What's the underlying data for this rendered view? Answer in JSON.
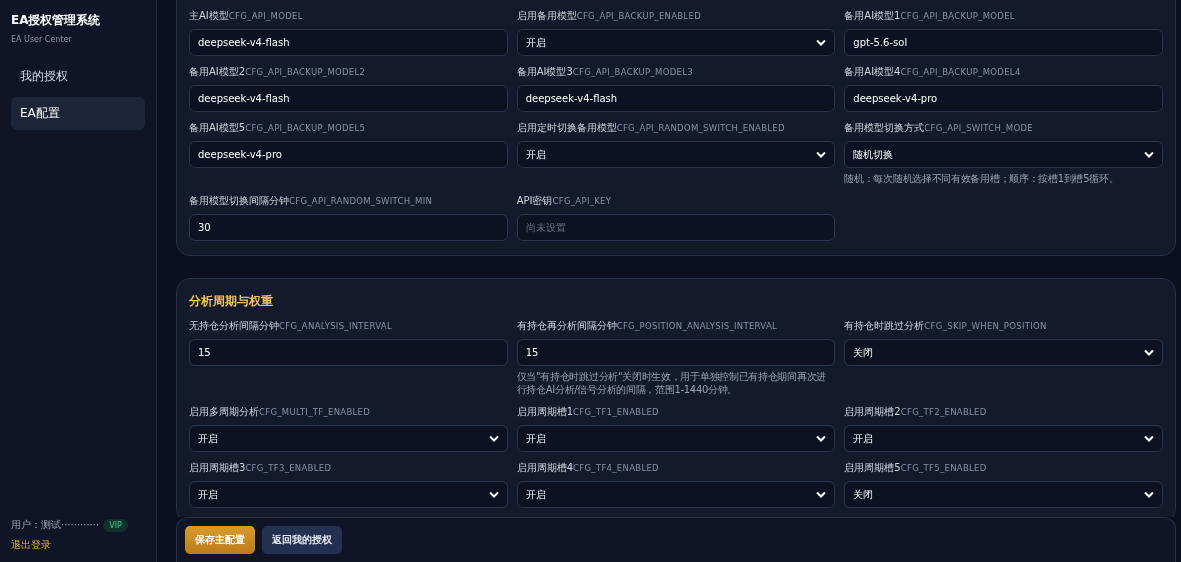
{
  "sidebar": {
    "title": "EA授权管理系统",
    "subtitle": "EA User Center",
    "nav": [
      {
        "label": "我的授权",
        "selected": false
      },
      {
        "label": "EA配置",
        "selected": true
      }
    ],
    "user": {
      "label": "用户：测试············",
      "badge": "VIP",
      "logout": "退出登录"
    }
  },
  "sections": [
    {
      "fields": [
        {
          "kind": "text",
          "label": "主AI模型",
          "key": "CFG_API_MODEL",
          "value": "deepseek-v4-flash"
        },
        {
          "kind": "select",
          "label": "启用备用模型",
          "key": "CFG_API_BACKUP_ENABLED",
          "value": "开启"
        },
        {
          "kind": "text",
          "label": "备用AI模型1",
          "key": "CFG_API_BACKUP_MODEL",
          "value": "gpt-5.6-sol"
        },
        {
          "kind": "text",
          "label": "备用AI模型2",
          "key": "CFG_API_BACKUP_MODEL2",
          "value": "deepseek-v4-flash"
        },
        {
          "kind": "text",
          "label": "备用AI模型3",
          "key": "CFG_API_BACKUP_MODEL3",
          "value": "deepseek-v4-flash"
        },
        {
          "kind": "text",
          "label": "备用AI模型4",
          "key": "CFG_API_BACKUP_MODEL4",
          "value": "deepseek-v4-pro"
        },
        {
          "kind": "text",
          "label": "备用AI模型5",
          "key": "CFG_API_BACKUP_MODEL5",
          "value": "deepseek-v4-pro"
        },
        {
          "kind": "select",
          "label": "启用定时切换备用模型",
          "key": "CFG_API_RANDOM_SWITCH_ENABLED",
          "value": "开启"
        },
        {
          "kind": "select",
          "label": "备用模型切换方式",
          "key": "CFG_API_SWITCH_MODE",
          "value": "随机切换",
          "hint": "随机：每次随机选择不同有效备用槽；顺序：按槽1到槽5循环。"
        },
        {
          "kind": "text",
          "label": "备用模型切换间隔分钟",
          "key": "CFG_API_RANDOM_SWITCH_MIN",
          "value": "30"
        },
        {
          "kind": "password",
          "label": "API密钥",
          "key": "CFG_API_KEY",
          "placeholder": "尚未设置"
        }
      ]
    },
    {
      "title": "分析周期与权重",
      "fields": [
        {
          "kind": "text",
          "label": "无持仓分析间隔分钟",
          "key": "CFG_ANALYSIS_INTERVAL",
          "value": "15"
        },
        {
          "kind": "text",
          "label": "有持仓再分析间隔分钟",
          "key": "CFG_POSITION_ANALYSIS_INTERVAL",
          "value": "15",
          "hint": "仅当\"有持仓时跳过分析\"关闭时生效，用于单独控制已有持仓期间再次进行持仓AI分析/信号分析的间隔，范围1-1440分钟。"
        },
        {
          "kind": "select",
          "label": "有持仓时跳过分析",
          "key": "CFG_SKIP_WHEN_POSITION",
          "value": "关闭"
        },
        {
          "kind": "select",
          "label": "启用多周期分析",
          "key": "CFG_MULTI_TF_ENABLED",
          "value": "开启"
        },
        {
          "kind": "select",
          "label": "启用周期槽1",
          "key": "CFG_TF1_ENABLED",
          "value": "开启"
        },
        {
          "kind": "select",
          "label": "启用周期槽2",
          "key": "CFG_TF2_ENABLED",
          "value": "开启"
        },
        {
          "kind": "select",
          "label": "启用周期槽3",
          "key": "CFG_TF3_ENABLED",
          "value": "开启"
        },
        {
          "kind": "select",
          "label": "启用周期槽4",
          "key": "CFG_TF4_ENABLED",
          "value": "开启"
        },
        {
          "kind": "select",
          "label": "启用周期槽5",
          "key": "CFG_TF5_ENABLED",
          "value": "关闭"
        }
      ]
    }
  ],
  "footer": {
    "buttons": [
      {
        "kind": "primary",
        "label": "保存主配置"
      },
      {
        "kind": "secondary",
        "label": "返回我的授权"
      }
    ]
  }
}
